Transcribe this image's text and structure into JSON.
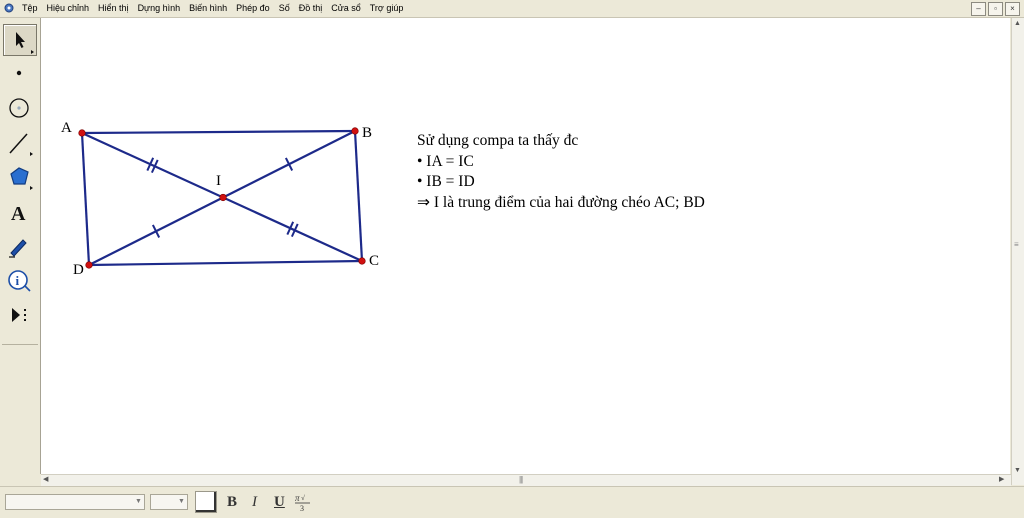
{
  "menu": {
    "items": [
      "Tệp",
      "Hiệu chỉnh",
      "Hiển thị",
      "Dựng hình",
      "Biến hình",
      "Phép đo",
      "Số",
      "Đồ thị",
      "Cửa sổ",
      "Trợ giúp"
    ]
  },
  "window_buttons": [
    "–",
    "▫",
    "×"
  ],
  "toolbox": {
    "tools": [
      "arrow-select",
      "point",
      "compass",
      "straightedge",
      "polygon",
      "text",
      "marker",
      "information",
      "custom"
    ],
    "selected": "arrow-select"
  },
  "figure": {
    "points": {
      "A": {
        "label": "A"
      },
      "B": {
        "label": "B"
      },
      "C": {
        "label": "C"
      },
      "D": {
        "label": "D"
      },
      "I": {
        "label": "I"
      }
    },
    "segments": [
      "AB",
      "BC",
      "CD",
      "DA",
      "AC",
      "BD"
    ],
    "tick_marks": {
      "IA": 2,
      "IC": 2,
      "IB": 1,
      "ID": 1
    },
    "line_color": "#1d2a8a",
    "point_color": "#d01010"
  },
  "note": {
    "line1": "Sử dụng compa ta thấy đc",
    "line2": "• IA = IC",
    "line3": "• IB = ID",
    "line4": "⇒ I là trung điểm của hai đường chéo AC; BD"
  },
  "bottom_toolbar": {
    "bold_label": "B",
    "italic_label": "I",
    "underline_label": "U"
  }
}
